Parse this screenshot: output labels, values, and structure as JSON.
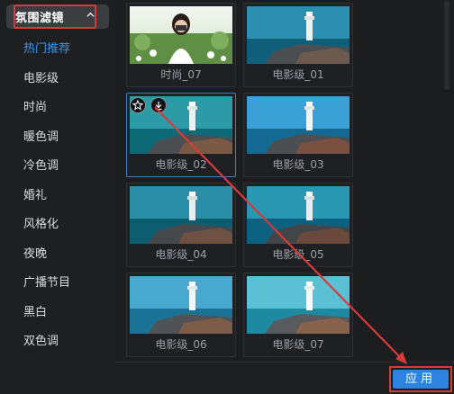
{
  "dropdown": {
    "label": "氛围滤镜",
    "icon": "chevron-up-icon"
  },
  "categories": [
    "热门推荐",
    "电影级",
    "时尚",
    "暖色调",
    "冷色调",
    "婚礼",
    "风格化",
    "夜晚",
    "广播节目",
    "黑白",
    "双色调"
  ],
  "active_category_index": 0,
  "filters": [
    {
      "label": "时尚_07",
      "style": "portrait"
    },
    {
      "label": "电影级_01",
      "style": "lighthouse"
    },
    {
      "label": "电影级_02",
      "style": "lighthouse",
      "selected": true
    },
    {
      "label": "电影级_03",
      "style": "lighthouse"
    },
    {
      "label": "电影级_04",
      "style": "lighthouse"
    },
    {
      "label": "电影级_05",
      "style": "lighthouse"
    },
    {
      "label": "电影级_06",
      "style": "lighthouse"
    },
    {
      "label": "电影级_07",
      "style": "lighthouse"
    }
  ],
  "card_actions": {
    "favorite_icon": "star-icon",
    "download_icon": "download-icon"
  },
  "apply_button": {
    "label": "应用"
  },
  "colors": {
    "accent": "#2c83e0",
    "annotation": "#d63a3a",
    "active_text": "#3d96e8"
  }
}
